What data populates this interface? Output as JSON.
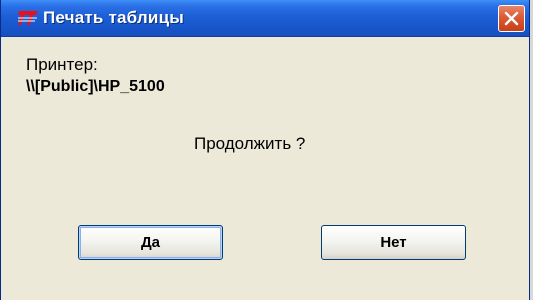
{
  "window": {
    "title": "Печать таблицы",
    "app_icon": "app-logo-icon",
    "close_icon": "close-icon"
  },
  "dialog": {
    "printer_label": "Принтер:",
    "printer_path": "\\\\[Public]\\HP_5100",
    "question": "Продолжить ?"
  },
  "buttons": {
    "yes_label": "Да",
    "no_label": "Нет"
  },
  "colors": {
    "titlebar": "#1d5fd6",
    "dialog_bg": "#ece9d8",
    "close_button": "#dc5a34",
    "button_border": "#003c74",
    "app_icon": "#e8111b"
  }
}
